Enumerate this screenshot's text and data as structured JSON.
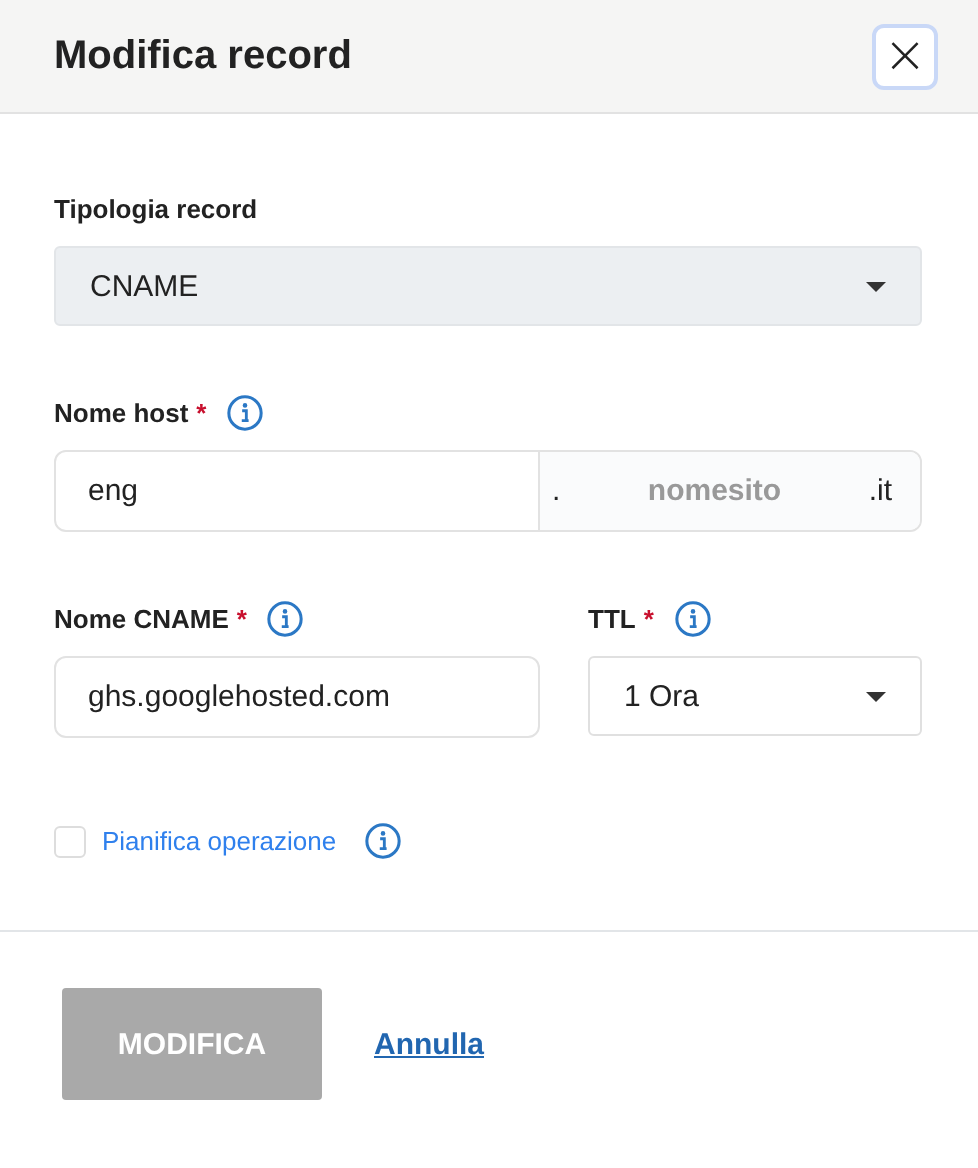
{
  "dialog": {
    "title": "Modifica record",
    "close_label": "×"
  },
  "record_type": {
    "label": "Tipologia record",
    "value": "CNAME"
  },
  "host": {
    "label": "Nome host",
    "required": true,
    "required_mark": "*",
    "value": "eng",
    "domain_prefix": ".",
    "domain_name": "nomesito",
    "domain_tld": ".it"
  },
  "cname": {
    "label": "Nome CNAME",
    "required": true,
    "required_mark": "*",
    "value": "ghs.googlehosted.com"
  },
  "ttl": {
    "label": "TTL",
    "required": true,
    "required_mark": "*",
    "value": "1 Ora"
  },
  "schedule": {
    "label": "Pianifica operazione",
    "checked": false
  },
  "buttons": {
    "submit": {
      "label": "MODIFICA",
      "disabled": true
    },
    "cancel": {
      "label": "Annulla"
    }
  }
}
